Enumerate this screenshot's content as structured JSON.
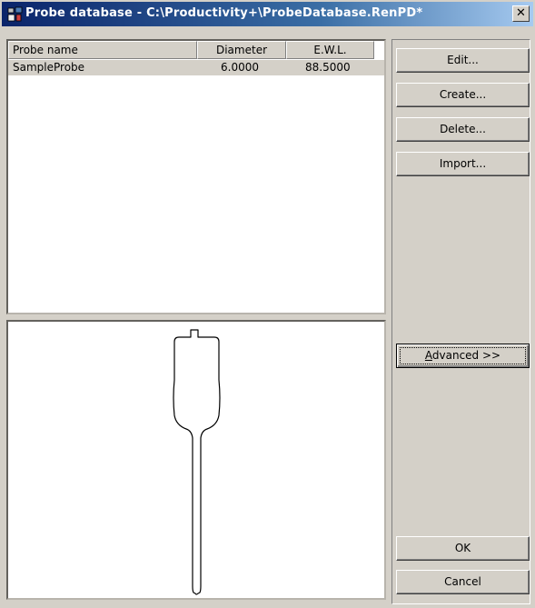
{
  "window": {
    "title": "Probe database - C:\\Productivity+\\ProbeDatabase.RenPD*",
    "close_label": "✕",
    "icon": "probe-database-app-icon"
  },
  "table": {
    "columns": [
      "Probe name",
      "Diameter",
      "E.W.L."
    ],
    "rows": [
      {
        "name": "SampleProbe",
        "diameter": "6.0000",
        "ewl": "88.5000"
      }
    ]
  },
  "buttons": {
    "edit": "Edit...",
    "create": "Create...",
    "delete": "Delete...",
    "import": "Import...",
    "advanced_mnemonic": "A",
    "advanced_rest": "dvanced >>",
    "ok": "OK",
    "cancel": "Cancel"
  },
  "preview": {
    "icon": "probe-outline-drawing"
  }
}
